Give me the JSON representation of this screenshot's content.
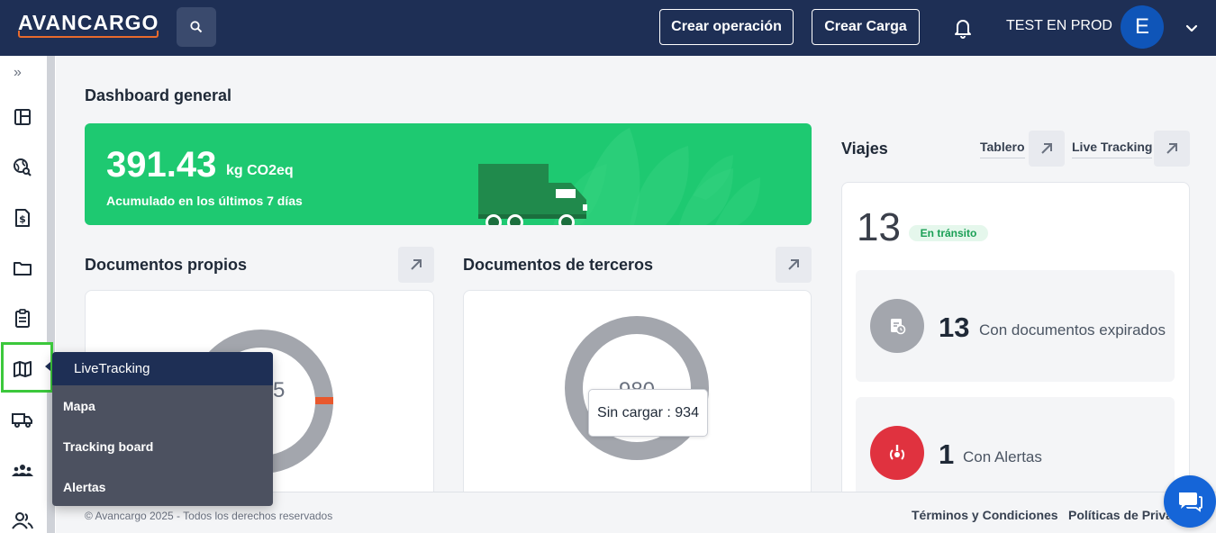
{
  "header": {
    "brand": "AVANCARGO",
    "create_operation": "Crear operación",
    "create_load": "Crear Carga",
    "user_name": "TEST EN PROD",
    "avatar_initial": "E"
  },
  "sidebar": {
    "expand_glyph": "»",
    "items": [
      "layout-icon",
      "search-globe-icon",
      "invoice-icon",
      "folder-icon",
      "clipboard-icon",
      "map-icon",
      "truck-icon",
      "group-icon",
      "users-icon"
    ],
    "active_item": "map-icon"
  },
  "flyout": {
    "title": "LiveTracking",
    "items": [
      "Mapa",
      "Tracking board",
      "Alertas"
    ]
  },
  "dashboard": {
    "title": "Dashboard general",
    "co2": {
      "value": "391.43",
      "unit": "kg CO2eq",
      "caption": "Acumulado en los últimos 7 días"
    },
    "docs_own": {
      "title": "Documentos propios",
      "center_value_partial": "5"
    },
    "docs_third": {
      "title": "Documentos de terceros",
      "center_value_partial": "980",
      "tooltip": "Sin cargar : 934"
    },
    "viajes": {
      "title": "Viajes",
      "link_board": "Tablero",
      "link_tracking": "Live Tracking",
      "in_transit_count": "13",
      "in_transit_label": "En tránsito",
      "expired_count": "13",
      "expired_label": "Con documentos expirados",
      "alerts_count": "1",
      "alerts_label": "Con Alertas"
    }
  },
  "footer": {
    "copyright": "© Avancargo 2025 - Todos los derechos reservados",
    "terms": "Términos y Condiciones",
    "privacy": "Políticas de Priva"
  },
  "colors": {
    "topbar": "#1e2f55",
    "green": "#1ec971",
    "accent_orange": "#e86a2d",
    "alert_red": "#e0323f",
    "active_outline": "#3cc83c"
  }
}
